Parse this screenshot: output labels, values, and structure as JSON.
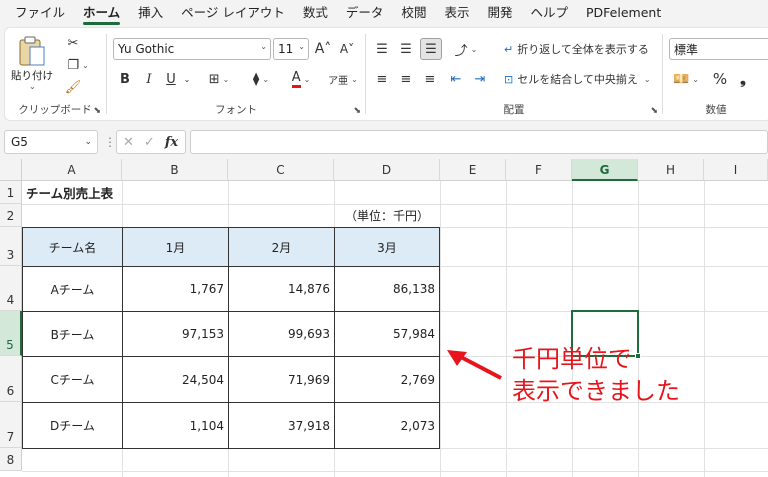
{
  "menu": {
    "tabs": [
      "ファイル",
      "ホーム",
      "挿入",
      "ページ レイアウト",
      "数式",
      "データ",
      "校閲",
      "表示",
      "開発",
      "ヘルプ",
      "PDFelement"
    ],
    "active_index": 1
  },
  "ribbon": {
    "clipboard": {
      "paste_label": "貼り付け",
      "group_label": "クリップボード"
    },
    "font": {
      "font_name": "Yu Gothic",
      "font_size": "11",
      "group_label": "フォント",
      "bold": "B",
      "italic": "I",
      "underline": "U",
      "font_color_accent": "#e8141c"
    },
    "alignment": {
      "wrap_text": "折り返して全体を表示する",
      "merge_center": "セルを結合して中央揃え",
      "group_label": "配置"
    },
    "number": {
      "format": "標準",
      "group_label": "数値",
      "percent": "%",
      "comma": "❟"
    }
  },
  "formula_bar": {
    "name_box": "G5",
    "fx": "fx",
    "value": ""
  },
  "sheet": {
    "columns": [
      "A",
      "B",
      "C",
      "D",
      "E",
      "F",
      "G",
      "H",
      "I"
    ],
    "selected_column": "G",
    "rows": [
      "1",
      "2",
      "3",
      "4",
      "5",
      "6",
      "7",
      "8"
    ],
    "selected_row": "5",
    "title": "チーム別売上表",
    "unit_note": "（単位：千円）",
    "table": {
      "headers": [
        "チーム名",
        "1月",
        "2月",
        "3月"
      ],
      "rows": [
        [
          "Aチーム",
          "1,767",
          "14,876",
          "86,138"
        ],
        [
          "Bチーム",
          "97,153",
          "99,693",
          "57,984"
        ],
        [
          "Cチーム",
          "24,504",
          "71,969",
          "2,769"
        ],
        [
          "Dチーム",
          "1,104",
          "37,918",
          "2,073"
        ]
      ]
    },
    "header_fill": "#ddebf7",
    "selection_color": "#1e6b3c"
  },
  "annotation": {
    "line1": "千円単位で",
    "line2": "表示できました",
    "color": "#e8141c"
  }
}
